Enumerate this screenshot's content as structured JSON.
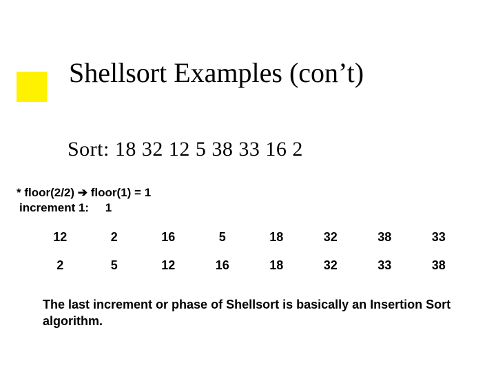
{
  "title": "Shellsort Examples (con’t)",
  "sort_prefix": "Sort: ",
  "sort_values": "18   32   12   5   38   33   16   2",
  "calc_prefix": "* floor(2/2) ",
  "calc_arrow": "➔",
  "calc_suffix": " floor(1) = 1",
  "inc_label": "increment 1:     1",
  "table_rows": [
    [
      "12",
      "2",
      "16",
      "5",
      "18",
      "32",
      "38",
      "33"
    ],
    [
      "2",
      "5",
      "12",
      "16",
      "18",
      "32",
      "33",
      "38"
    ]
  ],
  "closing": "The last increment or phase of Shellsort is basically an Insertion Sort algorithm."
}
